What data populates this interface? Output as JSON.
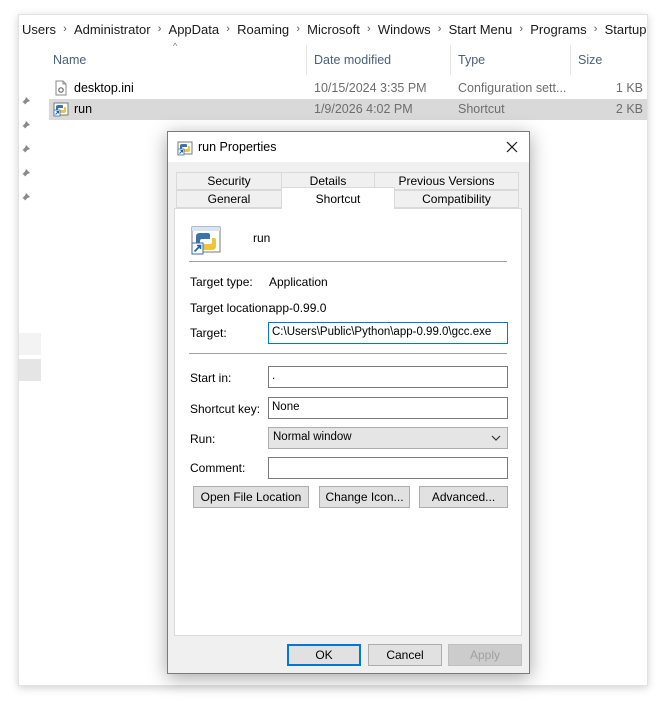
{
  "explorer": {
    "breadcrumb": [
      "Users",
      "Administrator",
      "AppData",
      "Roaming",
      "Microsoft",
      "Windows",
      "Start Menu",
      "Programs",
      "Startup"
    ],
    "columns": {
      "name": "Name",
      "date": "Date modified",
      "type": "Type",
      "size": "Size"
    },
    "files": [
      {
        "name": "desktop.ini",
        "date": "10/15/2024 3:35 PM",
        "type": "Configuration sett...",
        "size": "1 KB",
        "icon": "settings-file-icon",
        "selected": false
      },
      {
        "name": "run",
        "date": "1/9/2026 4:02 PM",
        "type": "Shortcut",
        "size": "2 KB",
        "icon": "python-shortcut-icon",
        "selected": true
      }
    ]
  },
  "dialog": {
    "title": "run Properties",
    "close_glyph": "✕",
    "tabs_top": [
      "Security",
      "Details",
      "Previous Versions"
    ],
    "tabs_bottom": [
      "General",
      "Shortcut",
      "Compatibility"
    ],
    "active_tab": "Shortcut",
    "shortcut_name": "run",
    "target_type_label": "Target type:",
    "target_type_value": "Application",
    "target_location_label": "Target location:",
    "target_location_value": "app-0.99.0",
    "target_label": "Target:",
    "target_value": "C:\\Users\\Public\\Python\\app-0.99.0\\gcc.exe",
    "start_in_label": "Start in:",
    "start_in_value": ".",
    "shortcut_key_label": "Shortcut key:",
    "shortcut_key_value": "None",
    "run_label": "Run:",
    "run_value": "Normal window",
    "comment_label": "Comment:",
    "comment_value": "",
    "buttons": {
      "open_file_location": "Open File Location",
      "change_icon": "Change Icon...",
      "advanced": "Advanced..."
    },
    "ok": "OK",
    "cancel": "Cancel",
    "apply": "Apply"
  }
}
